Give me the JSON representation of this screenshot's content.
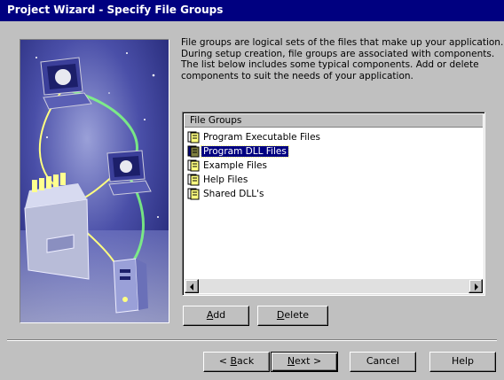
{
  "window": {
    "title": "Project Wizard - Specify File Groups"
  },
  "description": {
    "lines": [
      "File groups are logical sets of the files that make up your application.",
      "During setup creation, file groups are associated with components.",
      "The list below includes some typical components.  Add or delete",
      "components to suit the needs of your application."
    ]
  },
  "file_groups": {
    "header": "File Groups",
    "items": [
      {
        "label": "Program Executable Files",
        "selected": false
      },
      {
        "label": "Program DLL Files",
        "selected": true
      },
      {
        "label": "Example Files",
        "selected": false
      },
      {
        "label": "Help Files",
        "selected": false
      },
      {
        "label": "Shared DLL's",
        "selected": false
      }
    ]
  },
  "buttons": {
    "add": {
      "mnemonic": "A",
      "rest": "dd"
    },
    "delete": {
      "mnemonic": "D",
      "rest": "elete"
    },
    "back": {
      "prefix": "< ",
      "mnemonic": "B",
      "rest": "ack"
    },
    "next": {
      "mnemonic": "N",
      "rest": "ext >"
    },
    "cancel": "Cancel",
    "help": "Help"
  },
  "colors": {
    "titlebar": "#000080",
    "face": "#c0c0c0",
    "selection": "#000080"
  },
  "icons": {
    "file_group": "file-group-icon",
    "scroll_left": "scroll-left-arrow-icon",
    "scroll_right": "scroll-right-arrow-icon"
  }
}
